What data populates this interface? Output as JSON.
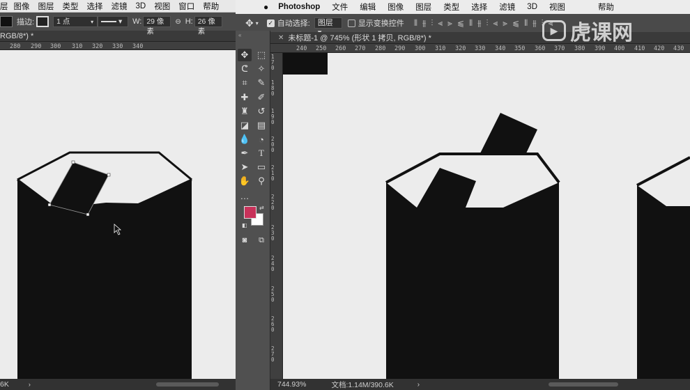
{
  "left": {
    "menu": [
      "层",
      "图像",
      "图层",
      "类型",
      "选择",
      "滤镜",
      "3D",
      "视图",
      "窗口",
      "帮助"
    ],
    "options": {
      "stroke_label": "描边:",
      "stroke_width": "1 点",
      "w_label": "W:",
      "w_value": "29 像素",
      "link_icon": "link-icon",
      "h_label": "H:",
      "h_value": "26 像素"
    },
    "doc_tab": "RGB/8*) *",
    "ruler_ticks": [
      "280",
      "290",
      "300",
      "310",
      "320",
      "330",
      "340"
    ],
    "status": "6K"
  },
  "right": {
    "menu": [
      "Photoshop",
      "文件",
      "编辑",
      "图像",
      "图层",
      "类型",
      "选择",
      "滤镜",
      "3D",
      "视图",
      "帮助"
    ],
    "options": {
      "auto_select_label": "自动选择:",
      "auto_select_value": "图层",
      "show_transform_label": "显示变换控件"
    },
    "doc_tab": "未标题-1 @ 745% (形状 1 拷贝, RGB/8*) *",
    "ruler_ticks": [
      "240",
      "250",
      "260",
      "270",
      "280",
      "290",
      "300",
      "310",
      "320",
      "330",
      "340",
      "350",
      "360",
      "370",
      "380",
      "390",
      "400",
      "410",
      "420",
      "430"
    ],
    "vruler_ticks": [
      "170",
      "180",
      "190",
      "200",
      "210",
      "220",
      "230",
      "240",
      "250",
      "260",
      "270"
    ],
    "status_zoom": "744.93%",
    "status_doc": "文档:1.14M/390.6K"
  },
  "colors": {
    "foreground": "#c8325a",
    "background": "#ffffff",
    "shape": "#111111",
    "canvas": "#ececec"
  },
  "watermark": "虎课网"
}
